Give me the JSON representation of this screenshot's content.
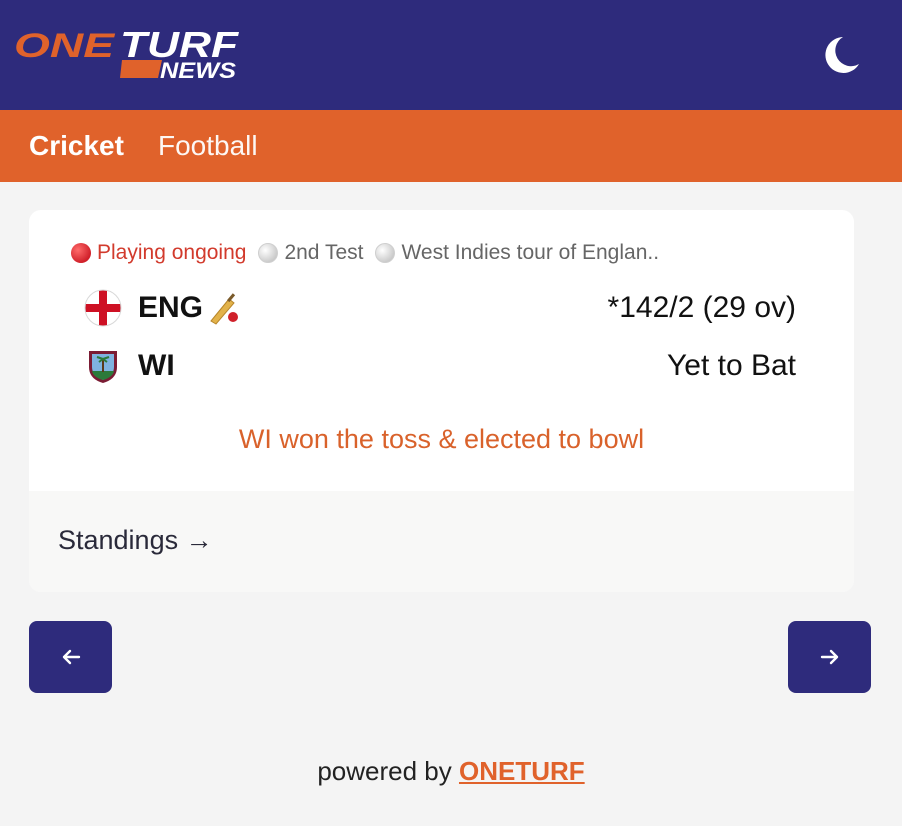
{
  "header": {
    "logo": {
      "line1_a": "ONE",
      "line1_b": "TURF",
      "line2": "NEWS"
    },
    "theme_toggle_icon": "moon-icon"
  },
  "nav": {
    "tabs": [
      {
        "label": "Cricket",
        "active": true
      },
      {
        "label": "Football",
        "active": false
      }
    ]
  },
  "match": {
    "status": "Playing ongoing",
    "match_type": "2nd Test",
    "series": "West Indies tour of Englan..",
    "teams": [
      {
        "name": "ENG",
        "flag": "england-flag-icon",
        "batting": true,
        "score": "*142/2 (29 ov)"
      },
      {
        "name": "WI",
        "flag": "west-indies-flag-icon",
        "batting": false,
        "score": "Yet to Bat"
      }
    ],
    "toss": "WI won the toss & elected to bowl",
    "standings_link": "Standings →"
  },
  "pager": {
    "prev_icon": "arrow-left-icon",
    "next_icon": "arrow-right-icon"
  },
  "footer": {
    "prefix": "powered by",
    "brand": "ONETURF"
  },
  "colors": {
    "primary": "#2e2b7c",
    "accent": "#e0622b",
    "live": "#d23a2c",
    "background": "#f4f4f4"
  }
}
